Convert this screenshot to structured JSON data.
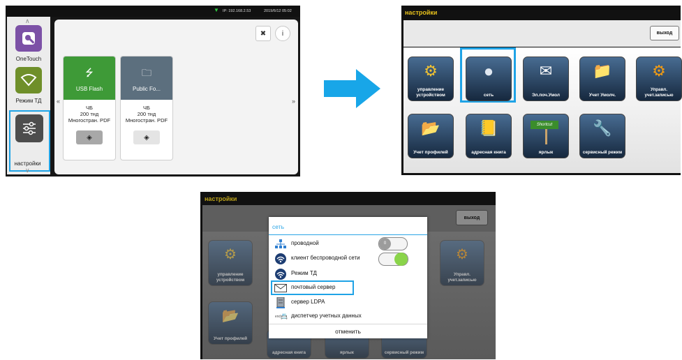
{
  "screen1": {
    "status": {
      "ip": "IP: 192.168.2.53",
      "datetime": "2019/6/12 05:02"
    },
    "left_items": [
      {
        "label": "OneTouch"
      },
      {
        "label": "Режим ТД"
      },
      {
        "label": "настройки"
      }
    ],
    "nav": {
      "prev": "«",
      "next": "»"
    },
    "cards": [
      {
        "name": "USB Flash",
        "line1": "ЧБ",
        "line2": "200 тнд",
        "line3": "Многостран. PDF"
      },
      {
        "name": "Public Fo...",
        "line1": "ЧБ",
        "line2": "200 тнд",
        "line3": "Многостран. PDF"
      }
    ]
  },
  "screen2": {
    "title": "настройки",
    "exit_label": "выход",
    "icons": [
      {
        "label": "управление устройством"
      },
      {
        "label": "сеть"
      },
      {
        "label": "Эл.поч.Умол"
      },
      {
        "label": "Учет Умолч."
      },
      {
        "label": "Управл. учет.записью"
      },
      {
        "label": "Учет профилей"
      },
      {
        "label": "адресная книга"
      },
      {
        "label": "ярлык",
        "badge": "Shortcut"
      },
      {
        "label": "сервисный режим"
      }
    ]
  },
  "screen3": {
    "title": "настройки",
    "exit_label": "выход",
    "bg_icons": [
      {
        "label": "управление устройством"
      },
      {
        "label": "Управл. учет.записью"
      },
      {
        "label": "Учет профилей"
      },
      {
        "label": "адресная книга"
      },
      {
        "label": "ярлык"
      },
      {
        "label": "сервисный режим"
      }
    ],
    "popup": {
      "title": "сеть",
      "items": [
        {
          "label": "проводной",
          "toggle": "off",
          "toggle_text": "0"
        },
        {
          "label": "клиент беспроводной сети",
          "toggle": "on"
        },
        {
          "label": "Режим ТД"
        },
        {
          "label": "почтовый сервер",
          "highlighted": true
        },
        {
          "label": "сервер LDPA"
        },
        {
          "label": "диспетчер учетных данных",
          "prefix": "end"
        }
      ],
      "cancel_label": "отменить"
    }
  },
  "colors": {
    "highlight": "#1fa3e6",
    "title_yellow": "#e8c21c",
    "toggle_green": "#8ad44a",
    "arrow": "#18a6e8"
  }
}
